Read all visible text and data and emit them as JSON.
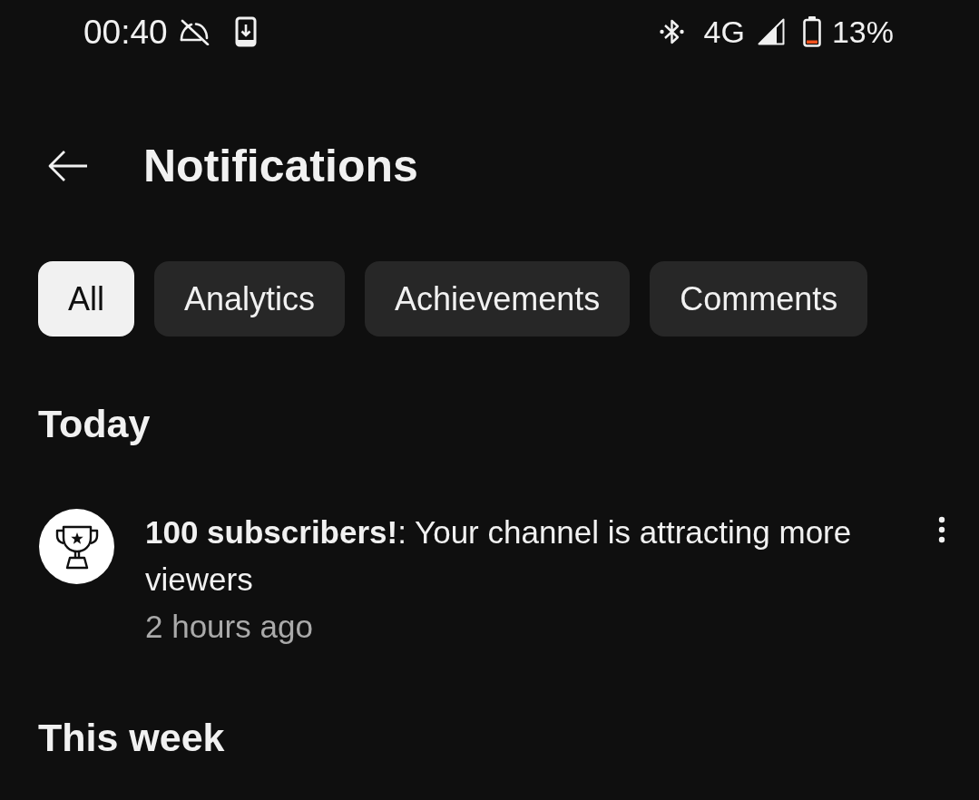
{
  "status_bar": {
    "time": "00:40",
    "network": "4G",
    "battery": "13%"
  },
  "header": {
    "title": "Notifications"
  },
  "chips": [
    {
      "label": "All",
      "selected": true
    },
    {
      "label": "Analytics",
      "selected": false
    },
    {
      "label": "Achievements",
      "selected": false
    },
    {
      "label": "Comments",
      "selected": false
    }
  ],
  "sections": [
    {
      "title": "Today",
      "notifications": [
        {
          "message": "**100 subscribers!**: Your channel is attracting more viewers",
          "time": "2 hours ago"
        }
      ]
    },
    {
      "title": "This week"
    }
  ]
}
